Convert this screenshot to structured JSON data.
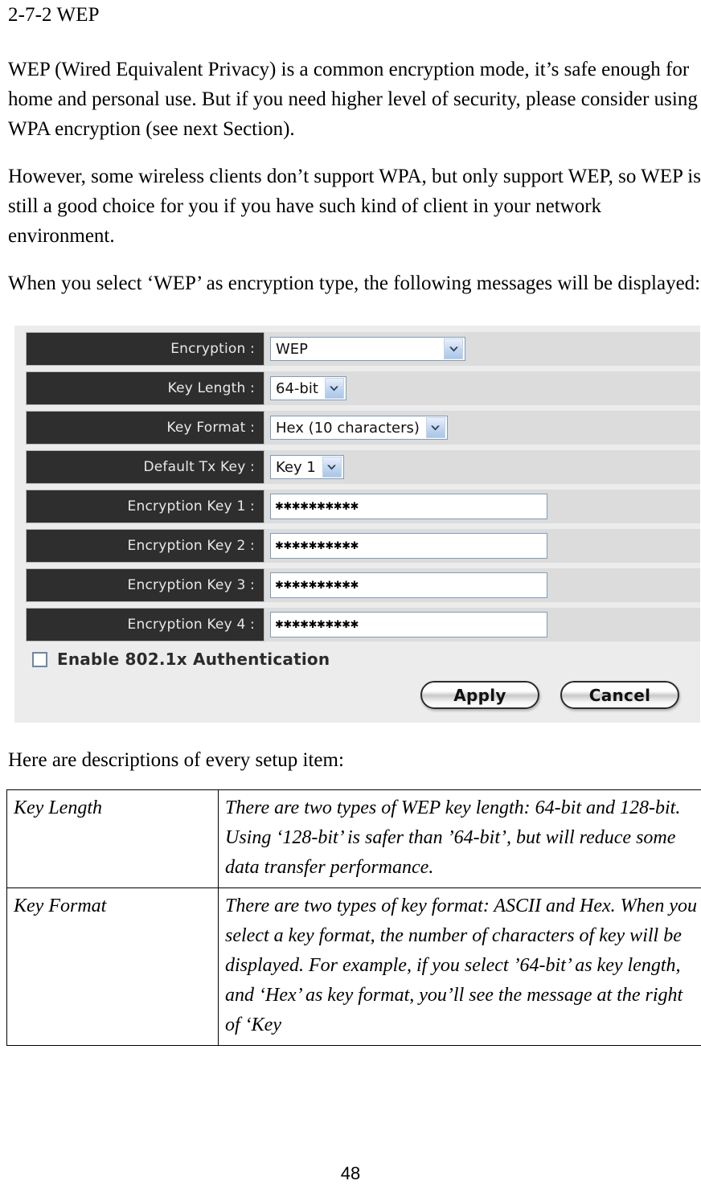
{
  "document": {
    "heading": "2-7-2 WEP",
    "paragraphs": [
      "WEP (Wired Equivalent Privacy) is a common encryption mode, it’s safe enough for home and personal use. But if you need higher level of security, please consider using WPA encryption (see next Section).",
      "However, some wireless clients don’t support WPA, but only support WEP, so WEP is still a good choice for you if you have such kind of client in your network environment.",
      "When you select ‘WEP’ as encryption type, the following messages will be displayed:"
    ],
    "after_figure_text": "Here are descriptions of every setup item:",
    "page_number": "48"
  },
  "ui_panel": {
    "rows": [
      {
        "label": "Encryption :",
        "control": "select",
        "value": "WEP",
        "width": "wide"
      },
      {
        "label": "Key Length :",
        "control": "select",
        "value": "64-bit",
        "width": "auto"
      },
      {
        "label": "Key Format :",
        "control": "select",
        "value": "Hex (10 characters)",
        "width": "auto"
      },
      {
        "label": "Default Tx Key :",
        "control": "select",
        "value": "Key 1",
        "width": "auto"
      },
      {
        "label": "Encryption Key 1 :",
        "control": "text",
        "value": "✱✱✱✱✱✱✱✱✱✱"
      },
      {
        "label": "Encryption Key 2 :",
        "control": "text",
        "value": "✱✱✱✱✱✱✱✱✱✱"
      },
      {
        "label": "Encryption Key 3 :",
        "control": "text",
        "value": "✱✱✱✱✱✱✱✱✱✱"
      },
      {
        "label": "Encryption Key 4 :",
        "control": "text",
        "value": "✱✱✱✱✱✱✱✱✱✱"
      }
    ],
    "checkbox": {
      "label": "Enable 802.1x Authentication",
      "checked": false
    },
    "buttons": {
      "apply": "Apply",
      "cancel": "Cancel"
    },
    "colors": {
      "panel_bg": "#ececec",
      "row_bg": "#dcdcdc",
      "label_bg": "#2e2e2e",
      "label_text": "#e8e8e8",
      "input_border": "#7f9db9",
      "arrow_button": "#aac6e8"
    }
  },
  "desc_table": {
    "rows": [
      {
        "term": "Key Length",
        "description": "There are two types of WEP key length: 64-bit and 128-bit. Using ‘128-bit’ is safer than ’64-bit’, but will reduce some data transfer performance."
      },
      {
        "term": "Key Format",
        "description": "There are two types of key format: ASCII and Hex. When you select a key format, the number of characters of key will be displayed. For example, if you select ’64-bit’ as key length, and ‘Hex’ as key format, you’ll see the message at the right of ‘Key"
      }
    ]
  }
}
